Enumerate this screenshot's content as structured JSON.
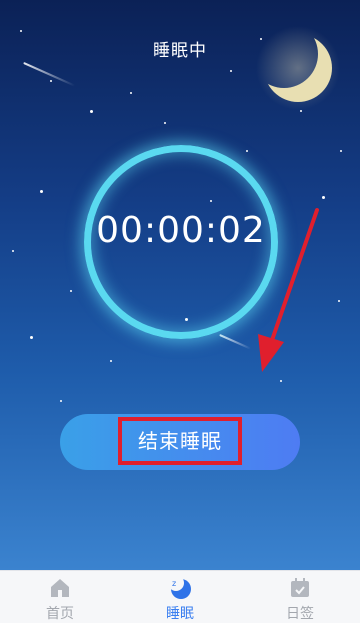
{
  "header": {
    "title": "睡眠中"
  },
  "timer": {
    "value": "00:00:02"
  },
  "action": {
    "end_label": "结束睡眠"
  },
  "tabs": [
    {
      "label": "首页",
      "icon": "home-icon",
      "active": false
    },
    {
      "label": "睡眠",
      "icon": "sleep-moon-icon",
      "active": true
    },
    {
      "label": "日签",
      "icon": "calendar-check-icon",
      "active": false
    }
  ],
  "colors": {
    "ring": "#5ad9f0",
    "button_start": "#3aa0e8",
    "button_end": "#4e7cf3",
    "highlight": "#e01f2d",
    "active_tab": "#3b7ff0",
    "inactive_tab": "#a3a7ae"
  }
}
